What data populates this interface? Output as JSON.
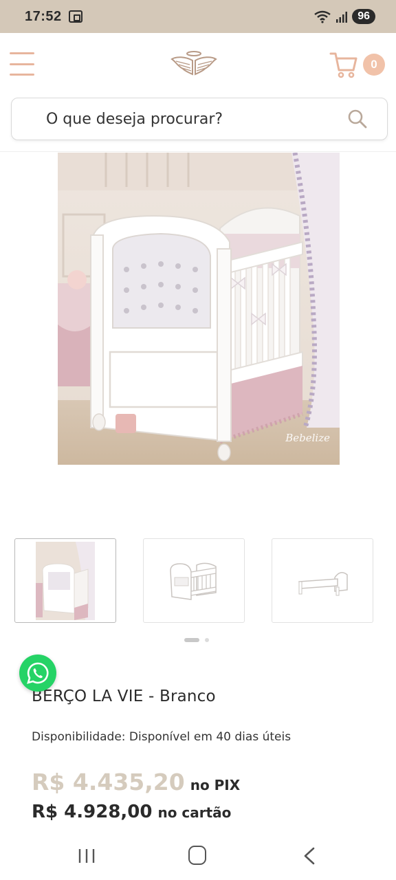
{
  "status_bar": {
    "time": "17:52",
    "battery": "96",
    "icons": [
      "screenshot-icon",
      "wifi-icon",
      "signal-icon"
    ]
  },
  "header": {
    "menu_icon": "hamburger-menu-icon",
    "logo": "angel-wings-logo",
    "cart_icon": "shopping-cart-icon",
    "cart_count": "0"
  },
  "search": {
    "placeholder": "O que deseja procurar?",
    "icon": "search-icon"
  },
  "gallery": {
    "main_image": "white-crib-with-lace-canopy",
    "watermark": "Bebelize",
    "thumbnails": [
      "crib-room-photo",
      "crib-white-product",
      "toddler-bed-product"
    ],
    "active_index": 0,
    "dot_count": 2
  },
  "whatsapp": {
    "icon": "whatsapp-icon"
  },
  "product": {
    "title": "BERÇO LA VIE - Branco",
    "availability_label": "Disponibilidade:",
    "availability_value": "Disponível em 40 dias úteis",
    "pix_price": "R$ 4.435,20",
    "pix_suffix": "no PIX",
    "card_price": "R$ 4.928,00",
    "card_suffix": "no cartão"
  },
  "colors": {
    "accent": "#e7b59d",
    "pix_price": "#d5cbbd",
    "whatsapp": "#25d366",
    "status_bar": "#d4c8b8"
  },
  "nav_bar": {
    "icons": [
      "recent-apps-icon",
      "home-icon",
      "back-icon"
    ]
  }
}
